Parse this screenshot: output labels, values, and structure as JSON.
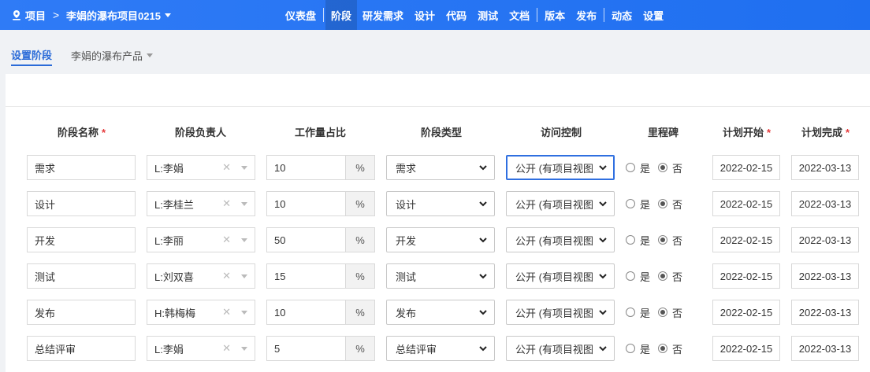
{
  "topbar": {
    "home_label": "项目",
    "separator": ">",
    "project_name": "李娟的瀑布项目0215",
    "nav": [
      {
        "label": "仪表盘",
        "active": false,
        "divider_after": true
      },
      {
        "label": "阶段",
        "active": true,
        "divider_after": false
      },
      {
        "label": "研发需求",
        "active": false,
        "divider_after": false
      },
      {
        "label": "设计",
        "active": false,
        "divider_after": false
      },
      {
        "label": "代码",
        "active": false,
        "divider_after": false
      },
      {
        "label": "测试",
        "active": false,
        "divider_after": false
      },
      {
        "label": "文档",
        "active": false,
        "divider_after": true
      },
      {
        "label": "版本",
        "active": false,
        "divider_after": false
      },
      {
        "label": "发布",
        "active": false,
        "divider_after": true
      },
      {
        "label": "动态",
        "active": false,
        "divider_after": false
      },
      {
        "label": "设置",
        "active": false,
        "divider_after": false
      }
    ],
    "colors": {
      "bar": "#2f7bf6"
    }
  },
  "subbar": {
    "tab": "设置阶段",
    "product": "李娟的瀑布产品"
  },
  "table": {
    "headers": {
      "name": "阶段名称",
      "owner": "阶段负责人",
      "workload": "工作量占比",
      "type": "阶段类型",
      "access": "访问控制",
      "milestone": "里程碑",
      "plan_start": "计划开始",
      "plan_end": "计划完成",
      "required_mark": "*"
    },
    "percent_unit": "%",
    "milestone_yes": "是",
    "milestone_no": "否",
    "rows": [
      {
        "name": "需求",
        "owner": "L:李娟",
        "workload": "10",
        "type": "需求",
        "access": "公开 (有项目视图",
        "milestone": "否",
        "start": "2022-02-15",
        "end": "2022-03-13"
      },
      {
        "name": "设计",
        "owner": "L:李桂兰",
        "workload": "10",
        "type": "设计",
        "access": "公开 (有项目视图",
        "milestone": "否",
        "start": "2022-02-15",
        "end": "2022-03-13"
      },
      {
        "name": "开发",
        "owner": "L:李丽",
        "workload": "50",
        "type": "开发",
        "access": "公开 (有项目视图",
        "milestone": "否",
        "start": "2022-02-15",
        "end": "2022-03-13"
      },
      {
        "name": "测试",
        "owner": "L:刘双喜",
        "workload": "15",
        "type": "测试",
        "access": "公开 (有项目视图",
        "milestone": "否",
        "start": "2022-02-15",
        "end": "2022-03-13"
      },
      {
        "name": "发布",
        "owner": "H:韩梅梅",
        "workload": "10",
        "type": "发布",
        "access": "公开 (有项目视图",
        "milestone": "否",
        "start": "2022-02-15",
        "end": "2022-03-13"
      },
      {
        "name": "总结评审",
        "owner": "L:李娟",
        "workload": "5",
        "type": "总结评审",
        "access": "公开 (有项目视图",
        "milestone": "否",
        "start": "2022-02-15",
        "end": "2022-03-13"
      }
    ]
  }
}
